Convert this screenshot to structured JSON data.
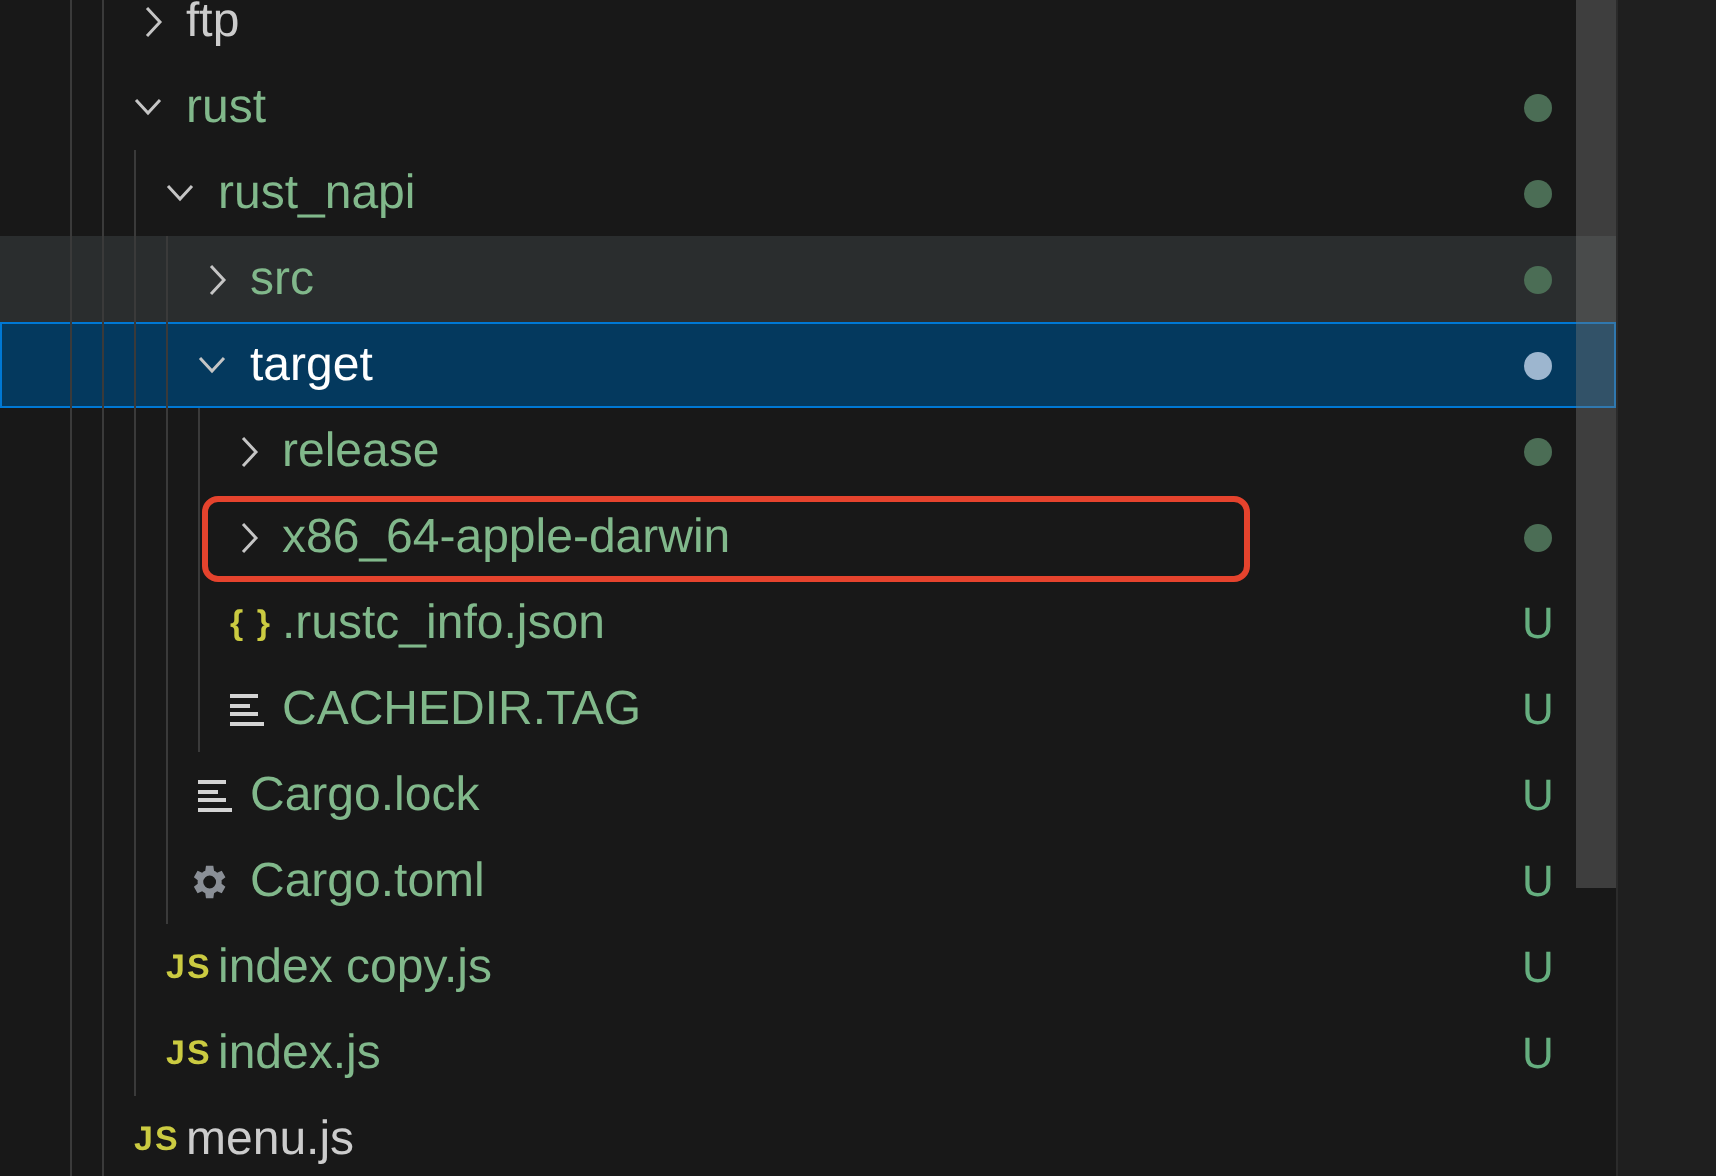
{
  "explorer": {
    "tree": [
      {
        "name": "ftp",
        "kind": "folder",
        "expanded": false,
        "untracked": false,
        "selected": false,
        "hovered": false
      },
      {
        "name": "rust",
        "kind": "folder",
        "expanded": true,
        "untracked": true,
        "selected": false,
        "hovered": false,
        "decoration": {
          "kind": "dot"
        },
        "children": [
          {
            "name": "rust_napi",
            "kind": "folder",
            "expanded": true,
            "untracked": true,
            "selected": false,
            "hovered": false,
            "decoration": {
              "kind": "dot"
            },
            "children": [
              {
                "name": "src",
                "kind": "folder",
                "expanded": false,
                "untracked": true,
                "selected": false,
                "hovered": true,
                "decoration": {
                  "kind": "dot"
                }
              },
              {
                "name": "target",
                "kind": "folder",
                "expanded": true,
                "untracked": true,
                "selected": true,
                "hovered": false,
                "decoration": {
                  "kind": "dot"
                },
                "children": [
                  {
                    "name": "release",
                    "kind": "folder",
                    "expanded": false,
                    "untracked": true,
                    "selected": false,
                    "hovered": false,
                    "decoration": {
                      "kind": "dot"
                    }
                  },
                  {
                    "name": "x86_64-apple-darwin",
                    "kind": "folder",
                    "expanded": false,
                    "untracked": true,
                    "selected": false,
                    "hovered": false,
                    "highlighted": true,
                    "decoration": {
                      "kind": "dot"
                    }
                  },
                  {
                    "name": ".rustc_info.json",
                    "kind": "file",
                    "icon": {
                      "kind": "glyph",
                      "label": "{ }",
                      "color": "#cbcb41"
                    },
                    "untracked": true,
                    "selected": false,
                    "hovered": false,
                    "decoration": {
                      "kind": "letter",
                      "text": "U"
                    }
                  },
                  {
                    "name": "CACHEDIR.TAG",
                    "kind": "file",
                    "icon": {
                      "kind": "lines"
                    },
                    "untracked": true,
                    "selected": false,
                    "hovered": false,
                    "decoration": {
                      "kind": "letter",
                      "text": "U"
                    }
                  }
                ]
              },
              {
                "name": "Cargo.lock",
                "kind": "file",
                "icon": {
                  "kind": "lines"
                },
                "untracked": true,
                "selected": false,
                "hovered": false,
                "decoration": {
                  "kind": "letter",
                  "text": "U"
                }
              },
              {
                "name": "Cargo.toml",
                "kind": "file",
                "icon": {
                  "kind": "gear"
                },
                "untracked": true,
                "selected": false,
                "hovered": false,
                "decoration": {
                  "kind": "letter",
                  "text": "U"
                }
              }
            ]
          },
          {
            "name": "index copy.js",
            "kind": "file",
            "icon": {
              "kind": "glyph",
              "label": "JS",
              "color": "#cbcb41"
            },
            "untracked": true,
            "selected": false,
            "hovered": false,
            "decoration": {
              "kind": "letter",
              "text": "U"
            }
          },
          {
            "name": "index.js",
            "kind": "file",
            "icon": {
              "kind": "glyph",
              "label": "JS",
              "color": "#cbcb41"
            },
            "untracked": true,
            "selected": false,
            "hovered": false,
            "decoration": {
              "kind": "letter",
              "text": "U"
            }
          }
        ]
      },
      {
        "name": "menu.js",
        "kind": "file",
        "icon": {
          "kind": "glyph",
          "label": "JS",
          "color": "#cbcb41"
        },
        "untracked": false,
        "selected": false,
        "hovered": false
      }
    ]
  }
}
